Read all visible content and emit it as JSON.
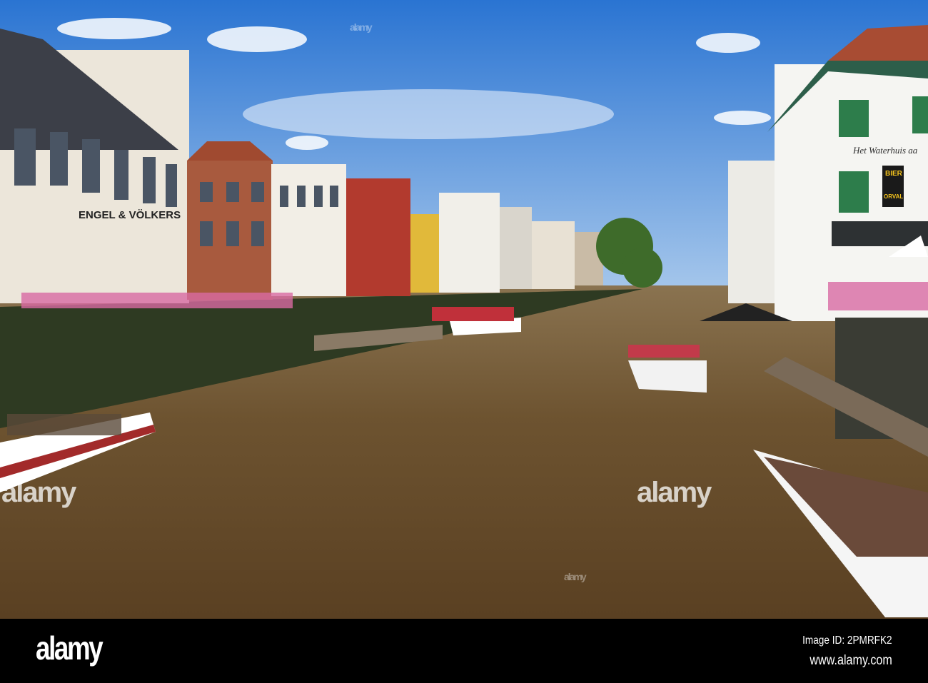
{
  "photo": {
    "signs": {
      "realtor": "ENGEL & VÖLKERS",
      "cafe": "Het Waterhuis aa",
      "beer": "BIER",
      "beer_brand": "ORVAL"
    },
    "watermarks": [
      "alamy",
      "alamy",
      "alamy",
      "alamy"
    ]
  },
  "footer": {
    "logo": "alamy",
    "image_id": "Image ID: 2PMRFK2",
    "url": "www.alamy.com"
  },
  "colors": {
    "sky": "#2f7fd6",
    "water": "#6b4f2a",
    "footer": "#000000"
  }
}
